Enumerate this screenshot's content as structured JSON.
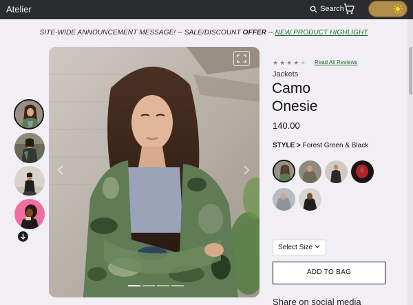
{
  "nav": {
    "brand": "Atelier",
    "search_label": "Search",
    "colors": {
      "bar": "#2b2c30",
      "toggle": "#b08d4b"
    }
  },
  "announcement": {
    "prefix": "SITE-WIDE ANNOUNCEMENT MESSAGE! -- SALE/DISCOUNT ",
    "offer": "OFFER",
    "separator": " -- ",
    "link": "NEW PRODUCT HIGHLIGHT"
  },
  "gallery": {
    "thumbnails": [
      {
        "name": "thumb-1",
        "active": true
      },
      {
        "name": "thumb-2",
        "active": false
      },
      {
        "name": "thumb-3",
        "active": false
      },
      {
        "name": "thumb-4",
        "active": false
      }
    ],
    "carousel_dots": 4,
    "active_dot": 0
  },
  "product": {
    "rating": 3.5,
    "rating_max": 5,
    "reviews_link": "Read All Reviews",
    "category": "Jackets",
    "name": "Camo Onesie",
    "price": "140.00",
    "style_label": "STYLE > ",
    "style_value": "Forest Green & Black",
    "styles_count": 6,
    "size_placeholder": "Select Size",
    "add_to_bag": "ADD TO BAG",
    "share_heading": "Share on social media"
  },
  "accent_color": "#1d6b2a"
}
